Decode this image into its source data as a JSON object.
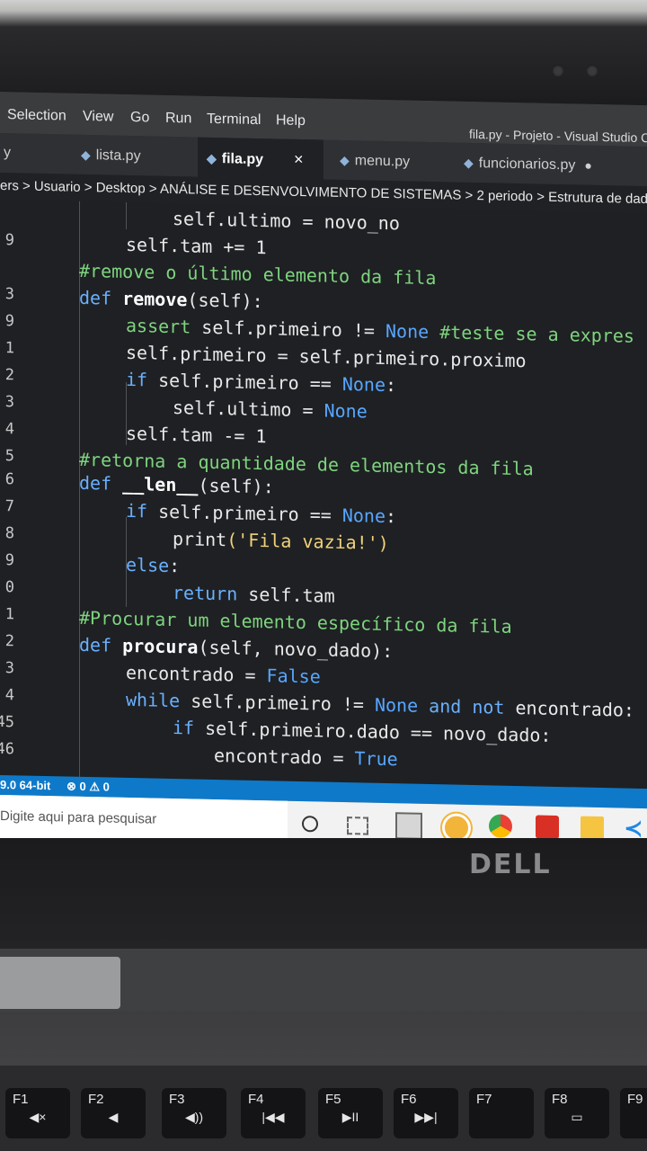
{
  "menu": {
    "items": [
      "Selection",
      "View",
      "Go",
      "Run",
      "Terminal",
      "Help"
    ],
    "window_title": "fila.py - Projeto - Visual Studio C"
  },
  "tabs": [
    {
      "label": "y"
    },
    {
      "label": "lista.py"
    },
    {
      "label": "fila.py",
      "close": "×"
    },
    {
      "label": "menu.py"
    },
    {
      "label": "funcionarios.py",
      "dot": "●"
    }
  ],
  "breadcrumb": "ers > Usuario > Desktop > ANÁLISE E DESENVOLVIMENTO DE SISTEMAS > 2 periodo > Estrutura de dados",
  "line_numbers": [
    "9",
    "",
    "3",
    "9",
    "1",
    "2",
    "3",
    "4",
    "5",
    "6",
    "7",
    "8",
    "9",
    "0",
    "1",
    "2",
    "3",
    "4",
    "45",
    "46"
  ],
  "code_lines": [
    [
      {
        "t": "self",
        "c": "v"
      },
      {
        "t": ".ultimo = novo_no",
        "c": "v"
      }
    ],
    [
      {
        "t": "self",
        "c": "v"
      },
      {
        "t": ".tam += 1",
        "c": "v"
      }
    ],
    [
      {
        "t": "#remove o último elemento da fila",
        "c": "c"
      }
    ],
    [
      {
        "t": "def ",
        "c": "k"
      },
      {
        "t": "remove",
        "c": "f"
      },
      {
        "t": "(self):",
        "c": "v"
      }
    ],
    [
      {
        "t": "assert ",
        "c": "c"
      },
      {
        "t": "self",
        "c": "v"
      },
      {
        "t": ".primeiro != ",
        "c": "v"
      },
      {
        "t": "None",
        "c": "n"
      },
      {
        "t": " #teste se a expres",
        "c": "c"
      }
    ],
    [
      {
        "t": "self",
        "c": "v"
      },
      {
        "t": ".primeiro = ",
        "c": "v"
      },
      {
        "t": "self",
        "c": "v"
      },
      {
        "t": ".primeiro.proximo",
        "c": "v"
      }
    ],
    [
      {
        "t": "if ",
        "c": "k"
      },
      {
        "t": "self",
        "c": "v"
      },
      {
        "t": ".primeiro == ",
        "c": "v"
      },
      {
        "t": "None",
        "c": "n"
      },
      {
        "t": ":",
        "c": "v"
      }
    ],
    [
      {
        "t": "self",
        "c": "v"
      },
      {
        "t": ".ultimo = ",
        "c": "v"
      },
      {
        "t": "None",
        "c": "n"
      }
    ],
    [
      {
        "t": "self",
        "c": "v"
      },
      {
        "t": ".tam -= 1",
        "c": "v"
      }
    ],
    [
      {
        "t": "#retorna a quantidade de elementos da fila",
        "c": "c"
      }
    ],
    [
      {
        "t": "def ",
        "c": "k"
      },
      {
        "t": "__len__",
        "c": "f"
      },
      {
        "t": "(self):",
        "c": "v"
      }
    ],
    [
      {
        "t": "if ",
        "c": "k"
      },
      {
        "t": "self",
        "c": "v"
      },
      {
        "t": ".primeiro == ",
        "c": "v"
      },
      {
        "t": "None",
        "c": "n"
      },
      {
        "t": ":",
        "c": "v"
      }
    ],
    [
      {
        "t": "print",
        "c": "v"
      },
      {
        "t": "('Fila vazia!')",
        "c": "s"
      }
    ],
    [
      {
        "t": "else",
        "c": "k"
      },
      {
        "t": ":",
        "c": "v"
      }
    ],
    [
      {
        "t": "return ",
        "c": "k"
      },
      {
        "t": "self",
        "c": "v"
      },
      {
        "t": ".tam",
        "c": "v"
      }
    ],
    [
      {
        "t": "#Procurar um elemento específico da fila",
        "c": "c"
      }
    ],
    [
      {
        "t": "def ",
        "c": "k"
      },
      {
        "t": "procura",
        "c": "f"
      },
      {
        "t": "(self, novo_dado):",
        "c": "v"
      }
    ],
    [
      {
        "t": "encontrado = ",
        "c": "v"
      },
      {
        "t": "False",
        "c": "n"
      }
    ],
    [
      {
        "t": "while ",
        "c": "k"
      },
      {
        "t": "self",
        "c": "v"
      },
      {
        "t": ".primeiro != ",
        "c": "v"
      },
      {
        "t": "None",
        "c": "n"
      },
      {
        "t": " and not ",
        "c": "k"
      },
      {
        "t": "encontrado:",
        "c": "v"
      }
    ],
    [
      {
        "t": "if ",
        "c": "k"
      },
      {
        "t": "self",
        "c": "v"
      },
      {
        "t": ".primeiro.dado == novo_dado:",
        "c": "v"
      }
    ],
    [
      {
        "t": "encontrado = ",
        "c": "v"
      },
      {
        "t": "True",
        "c": "n"
      }
    ]
  ],
  "status": {
    "python": "9.0 64-bit",
    "problems": "⊗ 0 ⚠ 0"
  },
  "taskbar": {
    "search_placeholder": "Digite aqui para pesquisar"
  },
  "laptop": {
    "logo": "DELL"
  },
  "fkeys": [
    {
      "label": "F1",
      "icon": "◀×"
    },
    {
      "label": "F2",
      "icon": "◀"
    },
    {
      "label": "F3",
      "icon": "◀))"
    },
    {
      "label": "F4",
      "icon": "|◀◀"
    },
    {
      "label": "F5",
      "icon": "▶II"
    },
    {
      "label": "F6",
      "icon": "▶▶|"
    },
    {
      "label": "F7",
      "icon": ""
    },
    {
      "label": "F8",
      "icon": "▭"
    },
    {
      "label": "F9",
      "icon": ""
    }
  ]
}
